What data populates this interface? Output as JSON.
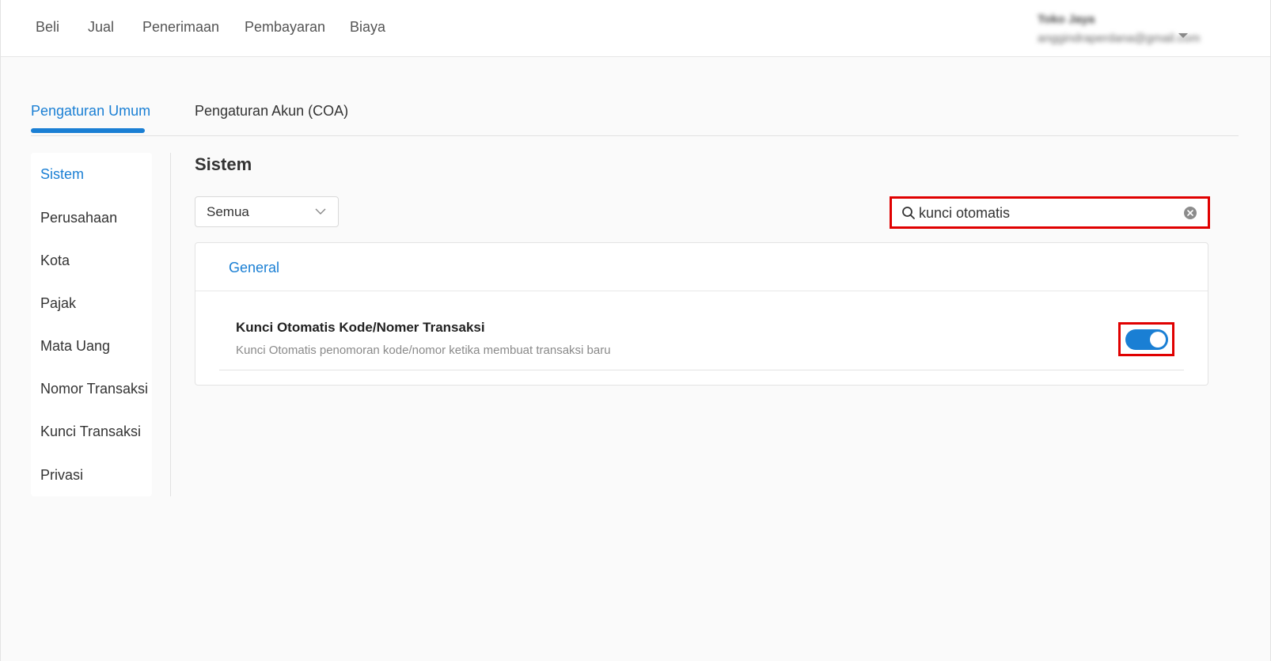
{
  "topnav": {
    "items": [
      {
        "label": "Beli"
      },
      {
        "label": "Jual"
      },
      {
        "label": "Penerimaan"
      },
      {
        "label": "Pembayaran"
      },
      {
        "label": "Biaya"
      }
    ],
    "user": {
      "name": "Toko Jaya",
      "email": "anggindraperdana@gmail.com"
    }
  },
  "tabs": [
    {
      "label": "Pengaturan Umum",
      "active": true
    },
    {
      "label": "Pengaturan Akun (COA)",
      "active": false
    }
  ],
  "sidebar": {
    "items": [
      {
        "label": "Sistem",
        "active": true
      },
      {
        "label": "Perusahaan"
      },
      {
        "label": "Kota"
      },
      {
        "label": "Pajak"
      },
      {
        "label": "Mata Uang"
      },
      {
        "label": "Nomor Transaksi"
      },
      {
        "label": "Kunci Transaksi"
      },
      {
        "label": "Privasi"
      }
    ]
  },
  "main": {
    "title": "Sistem",
    "filter": {
      "selected": "Semua"
    },
    "search": {
      "value": "kunci otomatis"
    },
    "card": {
      "header": "General",
      "setting": {
        "title": "Kunci Otomatis Kode/Nomer Transaksi",
        "description": "Kunci Otomatis penomoran kode/nomor ketika membuat transaksi baru",
        "enabled": true
      }
    }
  },
  "colors": {
    "accent": "#1a7fd4",
    "highlight": "#e00000"
  }
}
